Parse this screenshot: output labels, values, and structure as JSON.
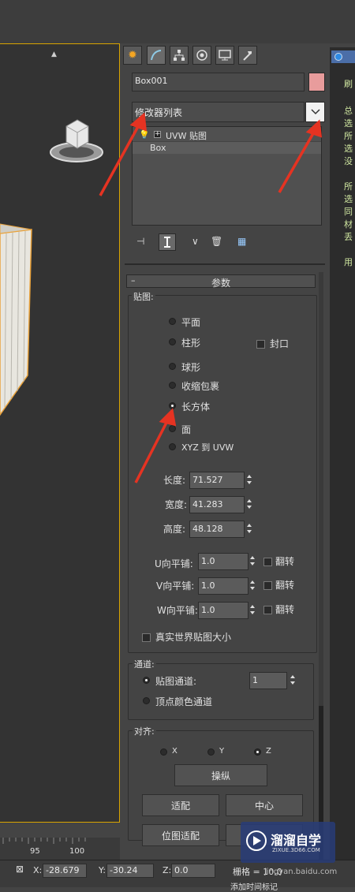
{
  "object": {
    "name": "Box001",
    "color": "#e89c9c"
  },
  "modifier_list": {
    "label": "修改器列表"
  },
  "stack": {
    "items": [
      "UVW 贴图",
      "Box"
    ]
  },
  "rollout": {
    "title": "参数",
    "collapse": "–"
  },
  "mapping": {
    "group_label": "贴图:",
    "options": [
      "平面",
      "柱形",
      "球形",
      "收缩包裹",
      "长方体",
      "面",
      "XYZ 到 UVW"
    ],
    "selected": "长方体",
    "cap_label": "封口"
  },
  "dims": {
    "length_label": "长度:",
    "length": "71.527",
    "width_label": "宽度:",
    "width": "41.283",
    "height_label": "高度:",
    "height": "48.128"
  },
  "tile": {
    "u_label": "U向平铺:",
    "u": "1.0",
    "v_label": "V向平铺:",
    "v": "1.0",
    "w_label": "W向平铺:",
    "w": "1.0",
    "flip_label": "翻转"
  },
  "real_world": {
    "label": "真实世界贴图大小"
  },
  "channel": {
    "group_label": "通道:",
    "map_channel_label": "贴图通道:",
    "map_channel": "1",
    "vertex_color_label": "顶点颜色通道"
  },
  "align": {
    "group_label": "对齐:",
    "axes": [
      "X",
      "Y",
      "Z"
    ],
    "selected": "Z",
    "manipulate": "操纵",
    "fit": "适配",
    "center": "中心",
    "bitmap_fit": "位图适配"
  },
  "right_panel": {
    "lines": [
      "刷",
      "总",
      "选",
      "所",
      "选",
      "没",
      "所",
      "选",
      "同",
      "材",
      "丢",
      "用"
    ]
  },
  "ruler": {
    "ticks": [
      "95",
      "100"
    ]
  },
  "status": {
    "x_label": "X:",
    "x": "-28.679",
    "y_label": "Y:",
    "y": "-30.24",
    "z_label": "Z:",
    "z": "0.0",
    "grid_label": "栅格 = 10.0",
    "bottom_text": "添加时间标记"
  },
  "watermark": {
    "brand": "溜溜自学",
    "url": "ZIXUE.3D66.COM",
    "site": "jingyan.baidu.com"
  },
  "colors": {
    "accent_orange": "#d9a400",
    "annotation_red": "#e53322"
  }
}
